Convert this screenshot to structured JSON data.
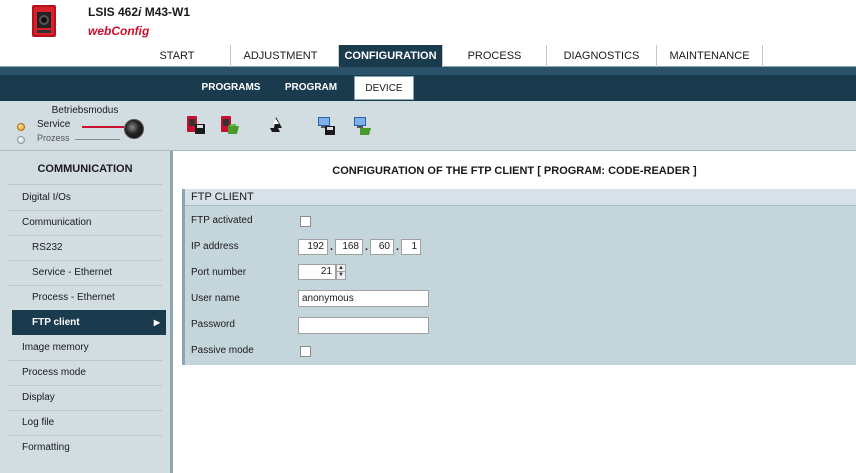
{
  "header": {
    "product_prefix": "LSIS 462",
    "product_italic": "i",
    "product_suffix": " M43-W1",
    "app_name": "webConfig"
  },
  "topnav": [
    {
      "label": "START"
    },
    {
      "label": "ADJUSTMENT"
    },
    {
      "label": "CONFIGURATION",
      "active": true
    },
    {
      "label": "PROCESS"
    },
    {
      "label": "DIAGNOSTICS"
    },
    {
      "label": "MAINTENANCE"
    }
  ],
  "subnav": [
    {
      "label": "PROGRAMS"
    },
    {
      "label": "PROGRAM"
    },
    {
      "label": "DEVICE",
      "active": true
    }
  ],
  "mode": {
    "title": "Betriebsmodus",
    "service_label": "Service",
    "prozess_label": "Prozess",
    "selected": "Service"
  },
  "toolbar": {
    "icons": [
      "device-save-icon",
      "device-load-icon",
      "recycle-reset-icon",
      "pc-save-icon",
      "pc-load-icon"
    ]
  },
  "sidebar": {
    "heading": "COMMUNICATION",
    "items": [
      {
        "label": "Digital I/Os"
      },
      {
        "label": "Communication"
      },
      {
        "label": "RS232"
      },
      {
        "label": "Service - Ethernet"
      },
      {
        "label": "Process - Ethernet"
      },
      {
        "label": "FTP client",
        "active": true
      },
      {
        "label": "Image memory"
      },
      {
        "label": "Process mode"
      },
      {
        "label": "Display"
      },
      {
        "label": "Log file"
      },
      {
        "label": "Formatting"
      }
    ]
  },
  "main": {
    "title": "CONFIGURATION OF THE FTP CLIENT   [ PROGRAM: CODE-READER ]",
    "panel_title": "FTP CLIENT",
    "fields": {
      "ftp_activated_label": "FTP activated",
      "ftp_activated": false,
      "ip_label": "IP address",
      "ip": [
        "192",
        "168",
        "60",
        "1"
      ],
      "port_label": "Port number",
      "port": "21",
      "user_label": "User name",
      "user": "anonymous",
      "password_label": "Password",
      "password": "",
      "passive_label": "Passive mode",
      "passive": false
    }
  },
  "colors": {
    "nav_dark": "#1a3a4e",
    "panel_bg": "#c5d5dc",
    "sidebar_bg": "#d2dde2",
    "brand_red": "#c8102e"
  }
}
